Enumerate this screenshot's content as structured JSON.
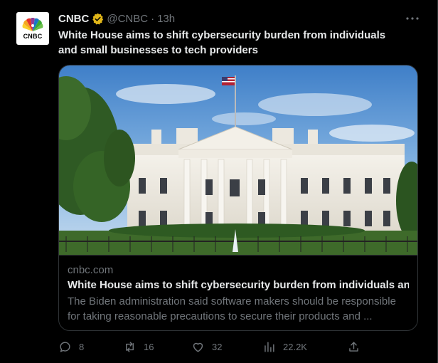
{
  "tweet": {
    "author_name": "CNBC",
    "handle": "@CNBC",
    "separator": "·",
    "time": "13h",
    "text": "White House aims to shift cybersecurity burden from individuals and small businesses to tech providers",
    "avatar_text": "CNBC"
  },
  "card": {
    "domain": "cnbc.com",
    "title": "White House aims to shift cybersecurity burden from individuals an...",
    "description": "The Biden administration said software makers should be responsible for taking reasonable precautions to secure their products and ..."
  },
  "actions": {
    "replies": "8",
    "reposts": "16",
    "likes": "32",
    "views": "22.2K"
  },
  "colors": {
    "background": "#000000",
    "text_primary": "#e7e9ea",
    "text_secondary": "#71767b",
    "verified_gold": "#e2b719",
    "border": "#2f3336"
  }
}
